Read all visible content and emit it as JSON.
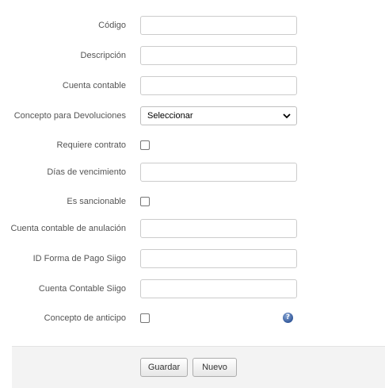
{
  "form": {
    "codigo": {
      "label": "Código",
      "value": ""
    },
    "descripcion": {
      "label": "Descripción",
      "value": ""
    },
    "cuenta_contable": {
      "label": "Cuenta contable",
      "value": ""
    },
    "concepto_devoluciones": {
      "label": "Concepto para Devoluciones",
      "selected": "Seleccionar"
    },
    "requiere_contrato": {
      "label": "Requiere contrato",
      "checked": false
    },
    "dias_vencimiento": {
      "label": "Días de vencimiento",
      "value": ""
    },
    "es_sancionable": {
      "label": "Es sancionable",
      "checked": false
    },
    "cuenta_anulacion": {
      "label": "Cuenta contable de anulación",
      "value": ""
    },
    "id_forma_pago_siigo": {
      "label": "ID Forma de Pago Siigo",
      "value": ""
    },
    "cuenta_contable_siigo": {
      "label": "Cuenta Contable Siigo",
      "value": ""
    },
    "concepto_anticipo": {
      "label": "Concepto de anticipo",
      "checked": false,
      "help_icon": "help-icon"
    }
  },
  "footer": {
    "save_label": "Guardar",
    "new_label": "Nuevo"
  }
}
